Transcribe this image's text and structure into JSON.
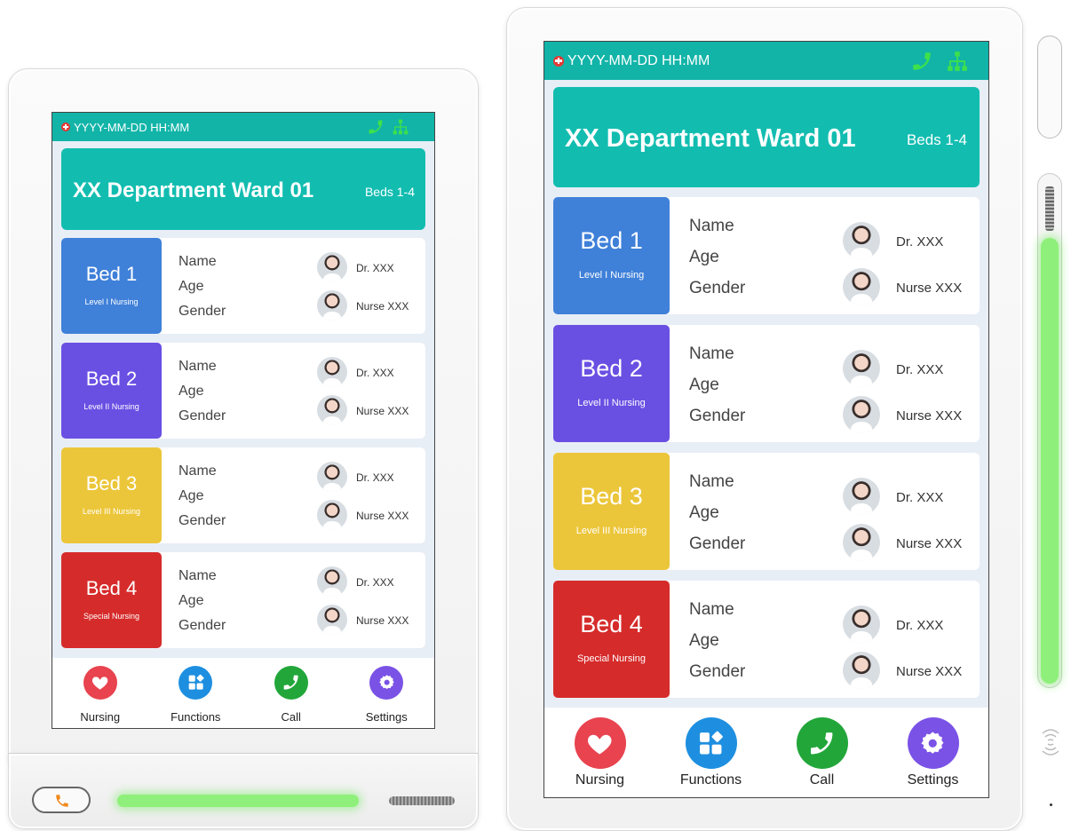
{
  "status": {
    "datetime": "YYYY-MM-DD  HH:MM",
    "datetime_small": "YYYY-MM-DD  HH:MM"
  },
  "ward": {
    "title": "XX Department Ward 01",
    "beds": "Beds 1-4"
  },
  "beds": [
    {
      "bed": "Bed 1",
      "level": "Level I Nursing",
      "color": "#3f80d9",
      "name": "Name",
      "age": "Age",
      "gender": "Gender",
      "doctor": "Dr. XXX",
      "nurse": "Nurse XXX"
    },
    {
      "bed": "Bed 2",
      "level": "Level II Nursing",
      "color": "#6a4fe3",
      "name": "Name",
      "age": "Age",
      "gender": "Gender",
      "doctor": "Dr. XXX",
      "nurse": "Nurse XXX"
    },
    {
      "bed": "Bed 3",
      "level": "Level III Nursing",
      "color": "#ecc63a",
      "name": "Name",
      "age": "Age",
      "gender": "Gender",
      "doctor": "Dr. XXX",
      "nurse": "Nurse XXX"
    },
    {
      "bed": "Bed 4",
      "level": "Special Nursing",
      "color": "#d62b2b",
      "name": "Name",
      "age": "Age",
      "gender": "Gender",
      "doctor": "Dr. XXX",
      "nurse": "Nurse XXX"
    }
  ],
  "nav": [
    {
      "label": "Nursing",
      "icon": "heart-icon",
      "color": "#e8434f"
    },
    {
      "label": "Functions",
      "icon": "functions-grid-icon",
      "color": "#1e8fe0"
    },
    {
      "label": "Call",
      "icon": "phone-icon",
      "color": "#22a63a"
    },
    {
      "label": "Settings",
      "icon": "gear-icon",
      "color": "#7a52e6"
    }
  ],
  "colors": {
    "teal_status": "#12b4a8",
    "teal_banner": "#12bdb0",
    "indicator_green": "#8ef07a",
    "call_orange": "#f08a1c"
  }
}
